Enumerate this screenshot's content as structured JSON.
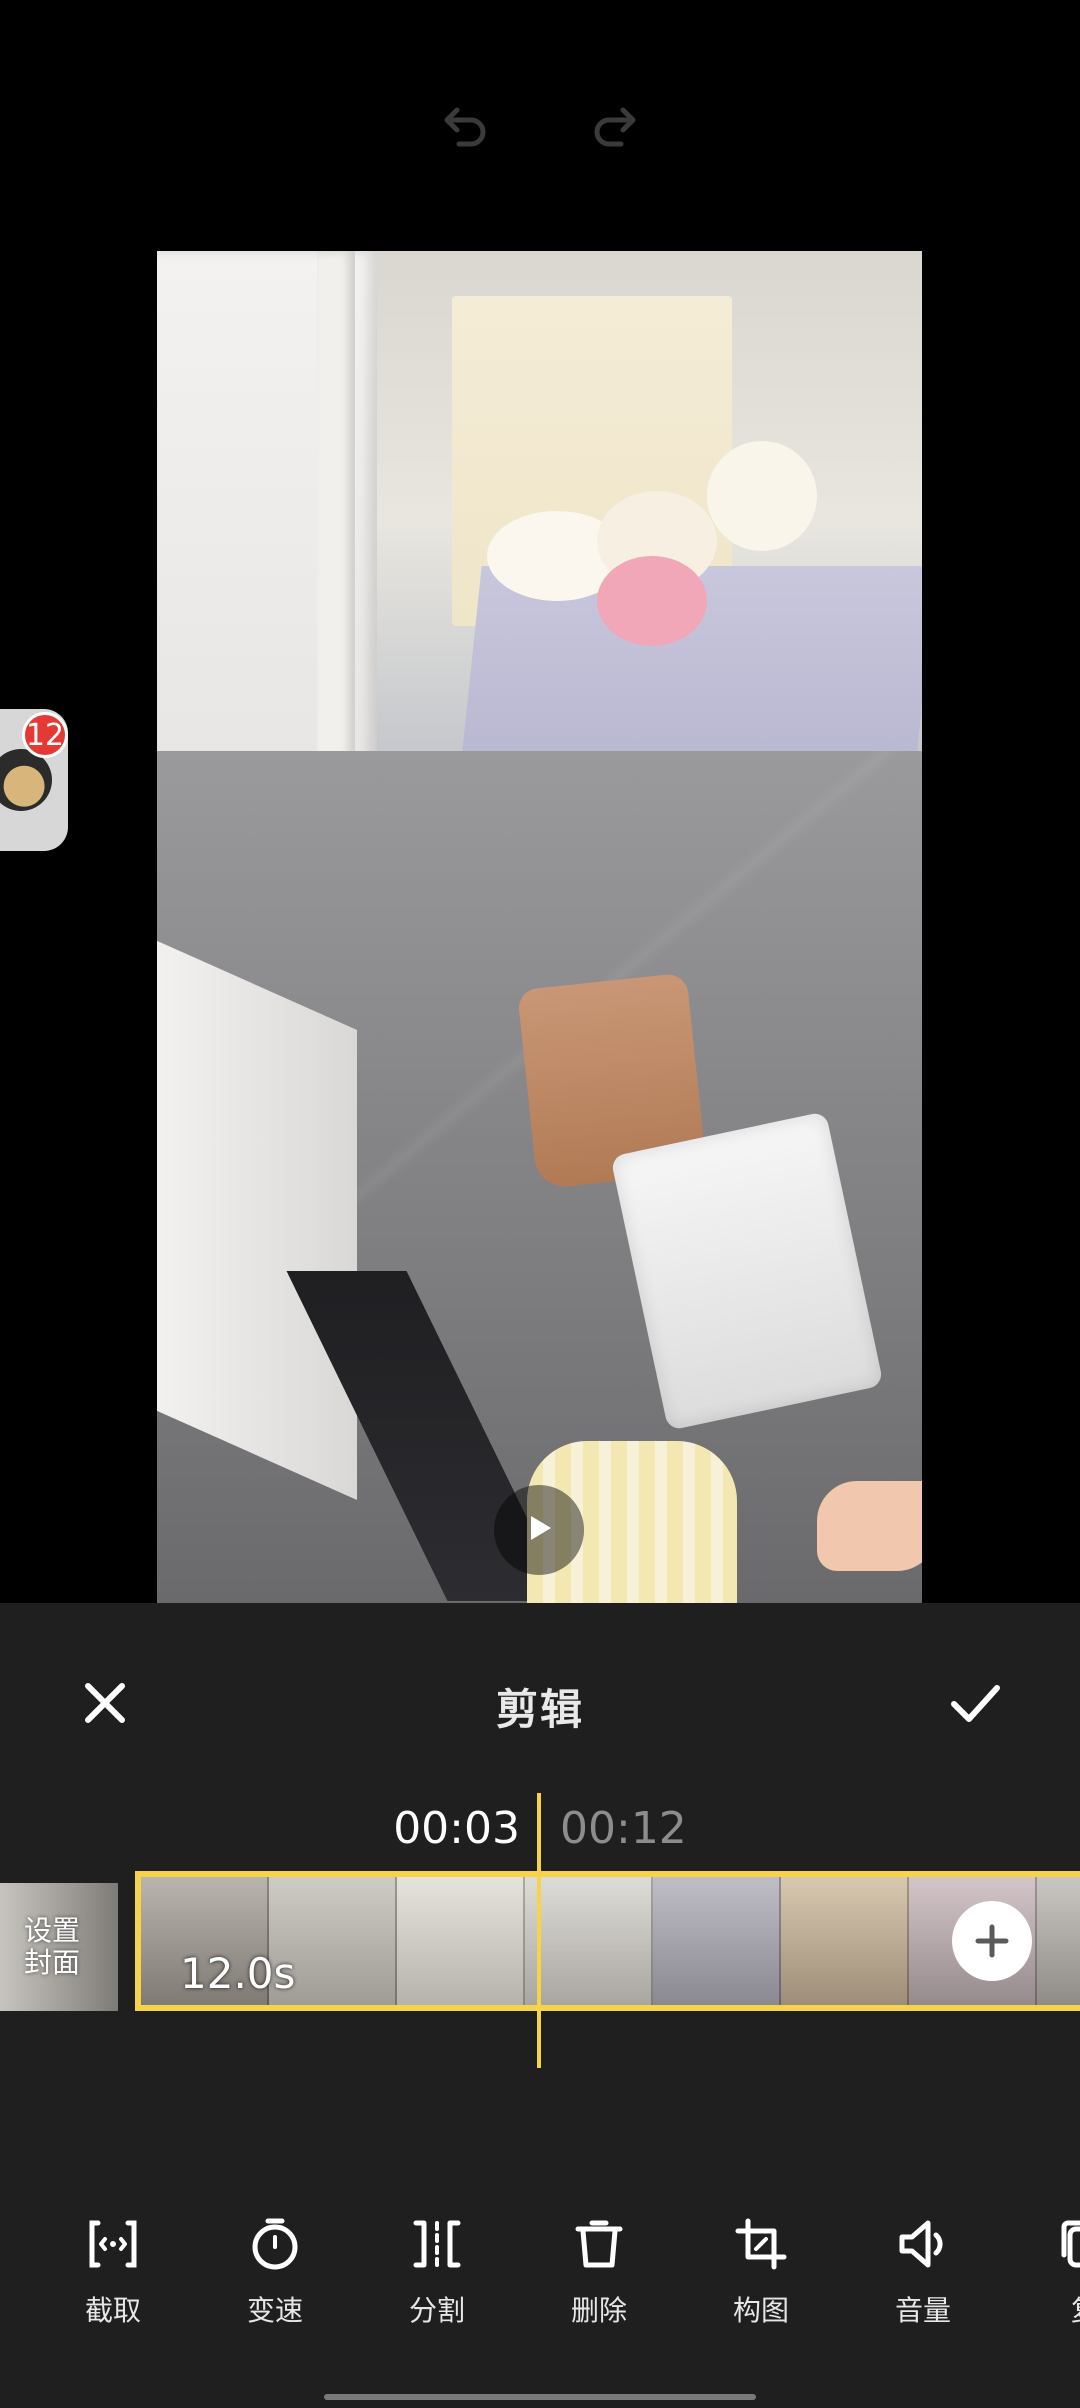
{
  "top_bar": {
    "undo_icon": "undo-icon",
    "redo_icon": "redo-icon"
  },
  "floating_bubble": {
    "badge_count": "12"
  },
  "preview": {
    "play_icon": "play-icon"
  },
  "edit_panel": {
    "title": "剪辑",
    "close_icon": "close-icon",
    "confirm_icon": "check-icon",
    "time_current": "00:03",
    "time_total": "00:12",
    "cover_label": "设置\n封面",
    "clip_duration": "12.0s",
    "add_clip_icon": "plus-icon"
  },
  "toolbar": {
    "items": [
      {
        "label": "截取",
        "icon": "trim-icon"
      },
      {
        "label": "变速",
        "icon": "speed-icon"
      },
      {
        "label": "分割",
        "icon": "split-icon"
      },
      {
        "label": "删除",
        "icon": "delete-icon"
      },
      {
        "label": "构图",
        "icon": "crop-icon"
      },
      {
        "label": "音量",
        "icon": "volume-icon"
      },
      {
        "label": "复",
        "icon": "copy-icon"
      }
    ]
  },
  "colors": {
    "accent": "#f5d34a",
    "panel_bg": "#1f1f1f",
    "badge": "#e53935"
  }
}
